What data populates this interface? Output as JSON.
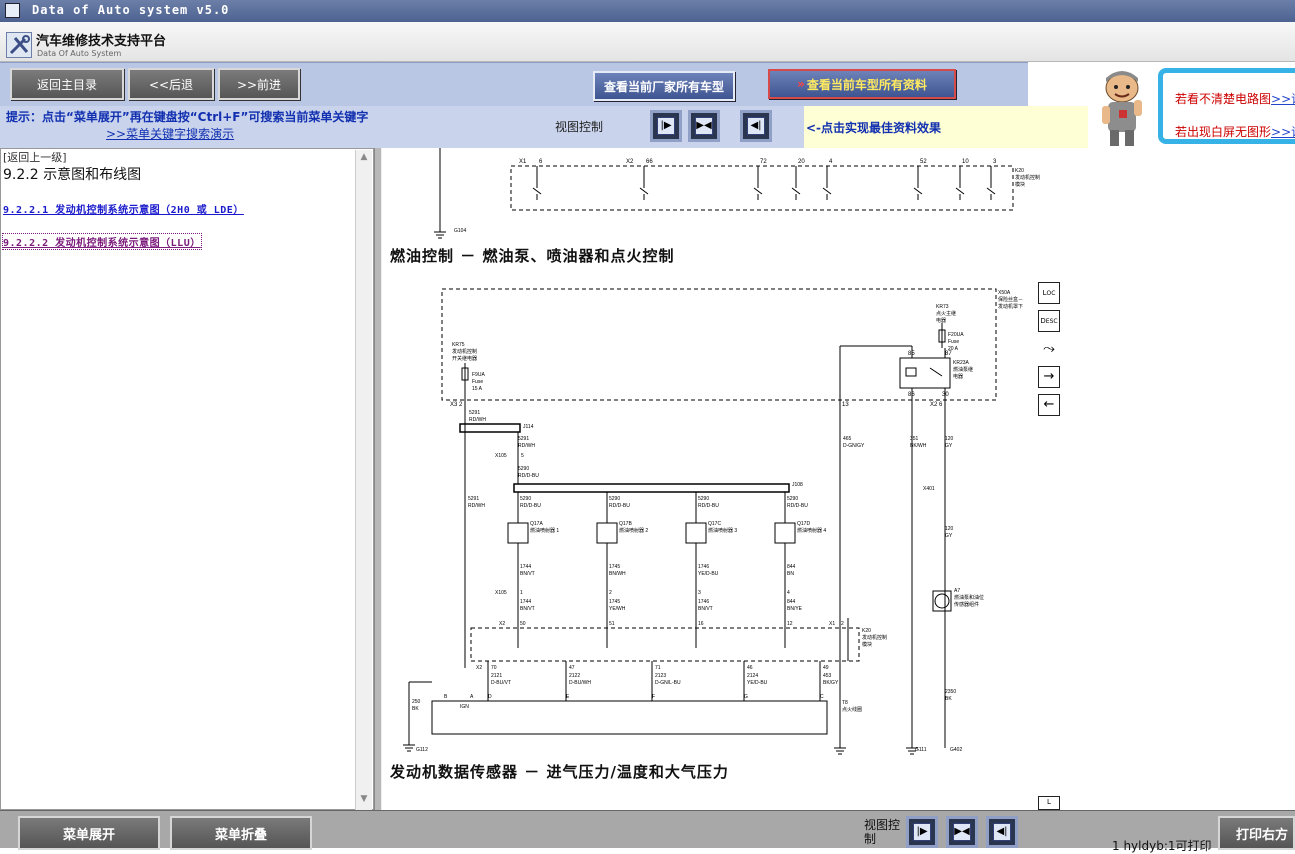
{
  "window": {
    "title": "Data of Auto system v5.0"
  },
  "header": {
    "title": "汽车维修技术支持平台",
    "subtitle": "Data Of Auto System"
  },
  "nav": {
    "main_menu": "返回主目录",
    "back": "<<后退",
    "forward": ">>前进",
    "all_models_label": "查看当前厂家所有车型",
    "all_info_label": "查看当前车型所有资料"
  },
  "promo": {
    "line1_text": "若看不清楚电路图",
    "line1_link": ">>请",
    "line2_text": "若出现白屏无图形",
    "line2_link": ">>请"
  },
  "hint": {
    "text": "提示：点击“菜单展开”再在键盘按“Ctrl+F”可搜索当前菜单关键字",
    "demo_link": ">>菜单关键字搜索演示",
    "view_control": "视图控制",
    "best_effect": "<-点击实现最佳资料效果"
  },
  "left": {
    "back_up": "[返回上一级]",
    "section_title": "9.2.2 示意图和布线图",
    "items": [
      {
        "label": "9.2.2.1 发动机控制系统示意图（2H0 或 LDE）",
        "color": "#1a1acc"
      },
      {
        "label": "9.2.2.2 发动机控制系统示意图（LLU）",
        "color": "#7a1a7a"
      }
    ]
  },
  "content": {
    "heading1": "燃油控制 － 燃油泵、喷油器和点火控制",
    "heading2": "发动机数据传感器 － 进气压力/温度和大气压力",
    "top_diagram": {
      "connectors": [
        {
          "conn": "X1",
          "pin": "6"
        },
        {
          "conn": "X2",
          "pin": "66"
        },
        {
          "conn": "",
          "pin": "72"
        },
        {
          "conn": "",
          "pin": "20"
        },
        {
          "conn": "",
          "pin": "4"
        },
        {
          "conn": "",
          "pin": "52"
        },
        {
          "conn": "",
          "pin": "10"
        },
        {
          "conn": "",
          "pin": "3"
        }
      ],
      "module": "K20\n发动机控制\n模块",
      "ground": "G104"
    },
    "diagram": {
      "x50a": "X50A\n保险丝盒－\n发动机罩下",
      "kr75": "KR75\n发动机控制\n开关继电器",
      "f9ua": "F9UA\nFuse\n15 A",
      "kr73": "KR73\n点火主继\n电器",
      "f20ua": "F20UA\nFuse\n20 A",
      "kr23a": "KR23A\n燃油泵继\n电器",
      "relay_pins": [
        "85",
        "87",
        "86",
        "30"
      ],
      "pin_x3_2": "X3 2",
      "pin_13": "13",
      "pin_x2_6": "X2 6",
      "w5291_top": "5291\nRD/WH",
      "j114": "J114",
      "w5291b": "5291\nRD/WH",
      "x105_5": "5",
      "x105_label": "X105",
      "w5290": "5290\nRD/D-BU",
      "j108": "J108",
      "w5291_side": "5291\nRD/WH",
      "w465": "465\nD-GN/GY",
      "w351": "351\nBK/WH",
      "w120a": "120\nGY",
      "x401": "X401",
      "w120b": "120\nGY",
      "a7": "A7\n燃油泵和油位\n传感器组件",
      "w2350": "2350\nBK",
      "injectors": [
        {
          "id": "Q17A",
          "name": "燃油喷射器 1",
          "in": "5290\nRD/D-BU",
          "out": "1744\nBN/VT",
          "pin": "1",
          "out2": "1744\nBN/VT",
          "k20pin": "50"
        },
        {
          "id": "Q17B",
          "name": "燃油喷射器 2",
          "in": "5290\nRD/D-BU",
          "out": "1745\nBN/WH",
          "pin": "2",
          "out2": "1745\nYE/WH",
          "k20pin": "51"
        },
        {
          "id": "Q17C",
          "name": "燃油喷射器 3",
          "in": "5290\nRD/D-BU",
          "out": "1746\nYE/D-BU",
          "pin": "3",
          "out2": "1746\nBN/VT",
          "k20pin": "16"
        },
        {
          "id": "Q17D",
          "name": "燃油喷射器 4",
          "in": "5290\nRD/D-BU",
          "out": "844\nBN",
          "pin": "4",
          "out2": "844\nBN/YE",
          "k20pin": "12"
        }
      ],
      "x2_label": "X2",
      "x1_label": "X1",
      "x1_pin": "2",
      "k20_label": "K20\n发动机控制\n模块",
      "lower_pins": [
        "70",
        "47",
        "71",
        "46",
        "49"
      ],
      "lower_wires": [
        "2121\nD-BU/VT",
        "2122\nD-BU/WH",
        "2123\nD-GN/L-BU",
        "2124\nYE/D-BU",
        "453\nBK/GY"
      ],
      "coil_pins": [
        "B",
        "A",
        "D",
        "E",
        "F",
        "G",
        "C"
      ],
      "ign": "IGN",
      "t8": "T8\n点火线圈",
      "w250": "250\nBK",
      "g112": "G112",
      "g111": "G111",
      "g402": "G402"
    },
    "side_icons": [
      "L\nOC",
      "D\nESC",
      "↯",
      "→",
      "←"
    ]
  },
  "bottom": {
    "expand": "菜单展开",
    "collapse": "菜单折叠",
    "view_control": "视图控\n制",
    "page_info": "1 hyldyb:1可打印",
    "print": "打印右方"
  }
}
